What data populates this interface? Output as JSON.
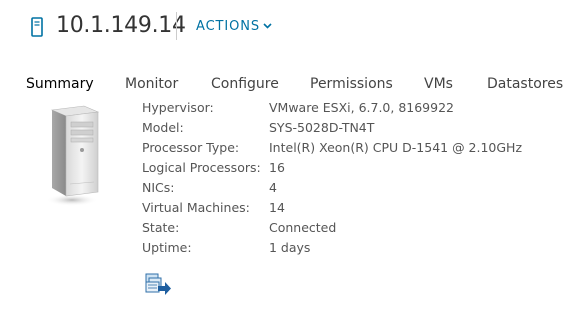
{
  "header": {
    "title": "10.1.149.14",
    "actions_label": "ACTIONS",
    "host_icon": "host-icon",
    "chevron_icon": "chevron-down-icon"
  },
  "tabs": [
    {
      "label": "Summary",
      "active": true
    },
    {
      "label": "Monitor",
      "active": false
    },
    {
      "label": "Configure",
      "active": false
    },
    {
      "label": "Permissions",
      "active": false
    },
    {
      "label": "VMs",
      "active": false
    },
    {
      "label": "Datastores",
      "active": false
    }
  ],
  "summary": {
    "server_image_icon": "server-tower-icon",
    "rows": [
      {
        "label": "Hypervisor:",
        "value": "VMware ESXi, 6.7.0, 8169922"
      },
      {
        "label": "Model:",
        "value": "SYS-5028D-TN4T"
      },
      {
        "label": "Processor Type:",
        "value": "Intel(R) Xeon(R) CPU D-1541 @ 2.10GHz"
      },
      {
        "label": "Logical Processors:",
        "value": "16"
      },
      {
        "label": "NICs:",
        "value": "4"
      },
      {
        "label": "Virtual Machines:",
        "value": "14"
      },
      {
        "label": "State:",
        "value": "Connected"
      },
      {
        "label": "Uptime:",
        "value": "1 days"
      }
    ],
    "action_icon": "migrate-vms-icon"
  },
  "colors": {
    "accent": "#0072a3",
    "text": "#333333",
    "label": "#555555",
    "divider": "#cccccc"
  }
}
